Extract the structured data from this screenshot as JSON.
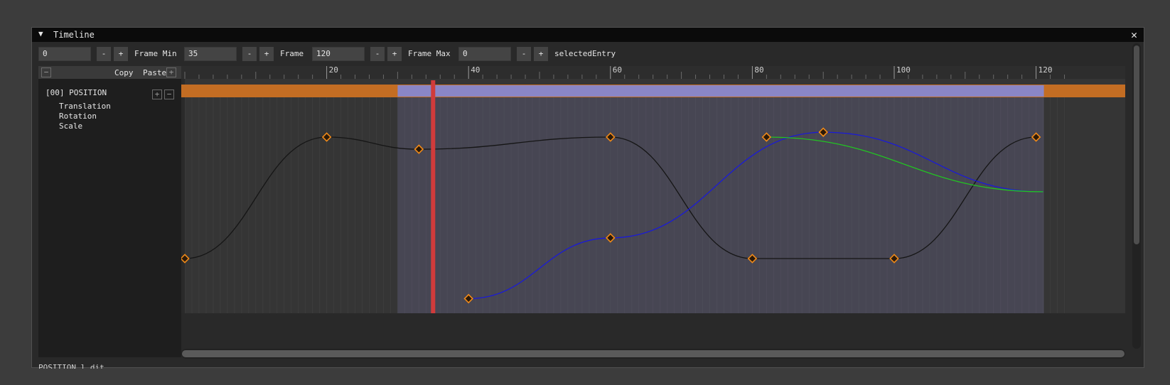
{
  "window": {
    "title": "Timeline",
    "collapse_icon": "triangle-down-icon",
    "close_icon": "close-icon",
    "close_glyph": "✕",
    "collapse_glyph": "▼"
  },
  "controls": {
    "current_frame": "0",
    "frame_min_label": "Frame Min",
    "frame_min": "35",
    "frame_label": "Frame",
    "frame": "120",
    "frame_max_label": "Frame Max",
    "frame_max": "0",
    "selected_label": "selectedEntry",
    "minus": "-",
    "plus": "+"
  },
  "left_panel": {
    "copy": "Copy",
    "paste": "Paste",
    "track_name": "[00] POSITION",
    "subtracks": [
      "Translation",
      "Rotation",
      "Scale"
    ]
  },
  "ruler": {
    "labels": [
      "20",
      "40",
      "60",
      "80",
      "100",
      "120"
    ]
  },
  "status_text": "  POSITION  l  dit",
  "colors": {
    "accent": "#c36d23",
    "range": "#8a86c6",
    "cursor": "#d13b3b",
    "curve_black": "#151515",
    "curve_blue": "#1a1ad8",
    "curve_green": "#22c422",
    "key": "#f08a19"
  },
  "chart_data": {
    "type": "line",
    "frame_range": [
      0,
      120
    ],
    "selected_range": [
      30,
      121
    ],
    "current_frame": 35,
    "series": [
      {
        "name": "",
        "keys": [
          [
            0,
            0.0
          ],
          [
            20,
            1.0
          ],
          [
            33,
            0.9
          ],
          [
            60,
            1.0
          ],
          [
            80,
            0.0
          ],
          [
            100,
            0.0
          ],
          [
            120,
            1.0
          ]
        ]
      },
      {
        "name": "",
        "keys": [
          [
            40,
            -0.33
          ],
          [
            60,
            0.17
          ],
          [
            90,
            1.04
          ],
          [
            121,
            0.55
          ]
        ]
      },
      {
        "name": "",
        "keys": [
          [
            82,
            1.0
          ],
          [
            121,
            0.55
          ]
        ]
      }
    ]
  }
}
